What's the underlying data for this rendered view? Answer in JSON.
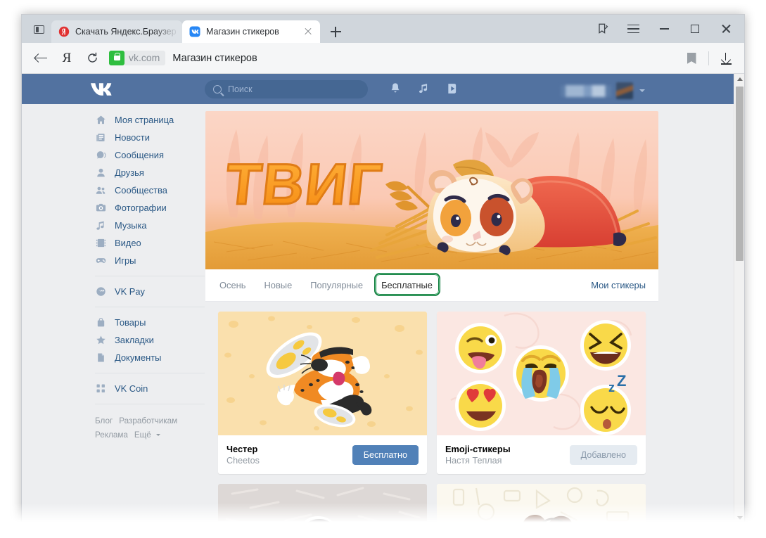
{
  "browser": {
    "sidebar_toggle": "sidebar-toggle",
    "tabs": [
      {
        "title": "Скачать Яндекс.Браузер д",
        "favicon": "yandex-icon",
        "active": false
      },
      {
        "title": "Магазин стикеров",
        "favicon": "vk-icon",
        "active": true
      }
    ],
    "new_tab": "+",
    "window_controls": {
      "collections": "collections-icon",
      "menu": "hamburger-icon",
      "minimize": "−",
      "maximize": "□",
      "close": "×"
    },
    "toolbar": {
      "back": "back-arrow-icon",
      "home_logo": "Я",
      "reload": "reload-icon",
      "lock": "lock-icon",
      "domain": "vk.com",
      "page_title": "Магазин стикеров",
      "bookmark": "bookmark-icon",
      "download": "download-icon"
    }
  },
  "vk": {
    "header": {
      "logo": "vk-logo",
      "search_placeholder": "Поиск",
      "icons": [
        "bell-icon",
        "music-note-icon",
        "video-play-icon"
      ],
      "user_name": "",
      "chevron": "chevron-down-icon"
    },
    "sidebar": {
      "items": [
        {
          "label": "Моя страница",
          "icon": "home-icon"
        },
        {
          "label": "Новости",
          "icon": "news-icon"
        },
        {
          "label": "Сообщения",
          "icon": "message-icon"
        },
        {
          "label": "Друзья",
          "icon": "friend-icon"
        },
        {
          "label": "Сообщества",
          "icon": "community-icon"
        },
        {
          "label": "Фотографии",
          "icon": "camera-icon"
        },
        {
          "label": "Музыка",
          "icon": "music-icon"
        },
        {
          "label": "Видео",
          "icon": "video-icon"
        },
        {
          "label": "Игры",
          "icon": "gamepad-icon"
        }
      ],
      "group2": [
        {
          "label": "VK Pay",
          "icon": "vkpay-icon"
        }
      ],
      "group3": [
        {
          "label": "Товары",
          "icon": "bag-icon"
        },
        {
          "label": "Закладки",
          "icon": "star-icon"
        },
        {
          "label": "Документы",
          "icon": "document-icon"
        }
      ],
      "group4": [
        {
          "label": "VK Coin",
          "icon": "vkcoin-icon"
        }
      ],
      "footer_links": [
        "Блог",
        "Разработчикам",
        "Реклама",
        "Ещё"
      ]
    },
    "banner": {
      "title": "ТВИГ",
      "art": "guinea-pig-in-hay-illustration"
    },
    "tabs": [
      {
        "label": "Осень",
        "selected": false
      },
      {
        "label": "Новые",
        "selected": false
      },
      {
        "label": "Популярные",
        "selected": false
      },
      {
        "label": "Бесплатные",
        "selected": true
      }
    ],
    "my_stickers_link": "Мои стикеры",
    "highlight_color": "#0f7b3d",
    "accent_color": "#5181b8",
    "header_color": "#5272a0",
    "page_bg": "#edeef0",
    "cards": [
      {
        "name": "Честер",
        "author": "Cheetos",
        "button": "Бесплатно",
        "button_state": "free",
        "art": "cheetos-chester-cheetah-sticker"
      },
      {
        "name": "Emoji-стикеры",
        "author": "Настя Теплая",
        "button": "Добавлено",
        "button_state": "added",
        "art": "emoji-faces-stickers"
      }
    ]
  }
}
